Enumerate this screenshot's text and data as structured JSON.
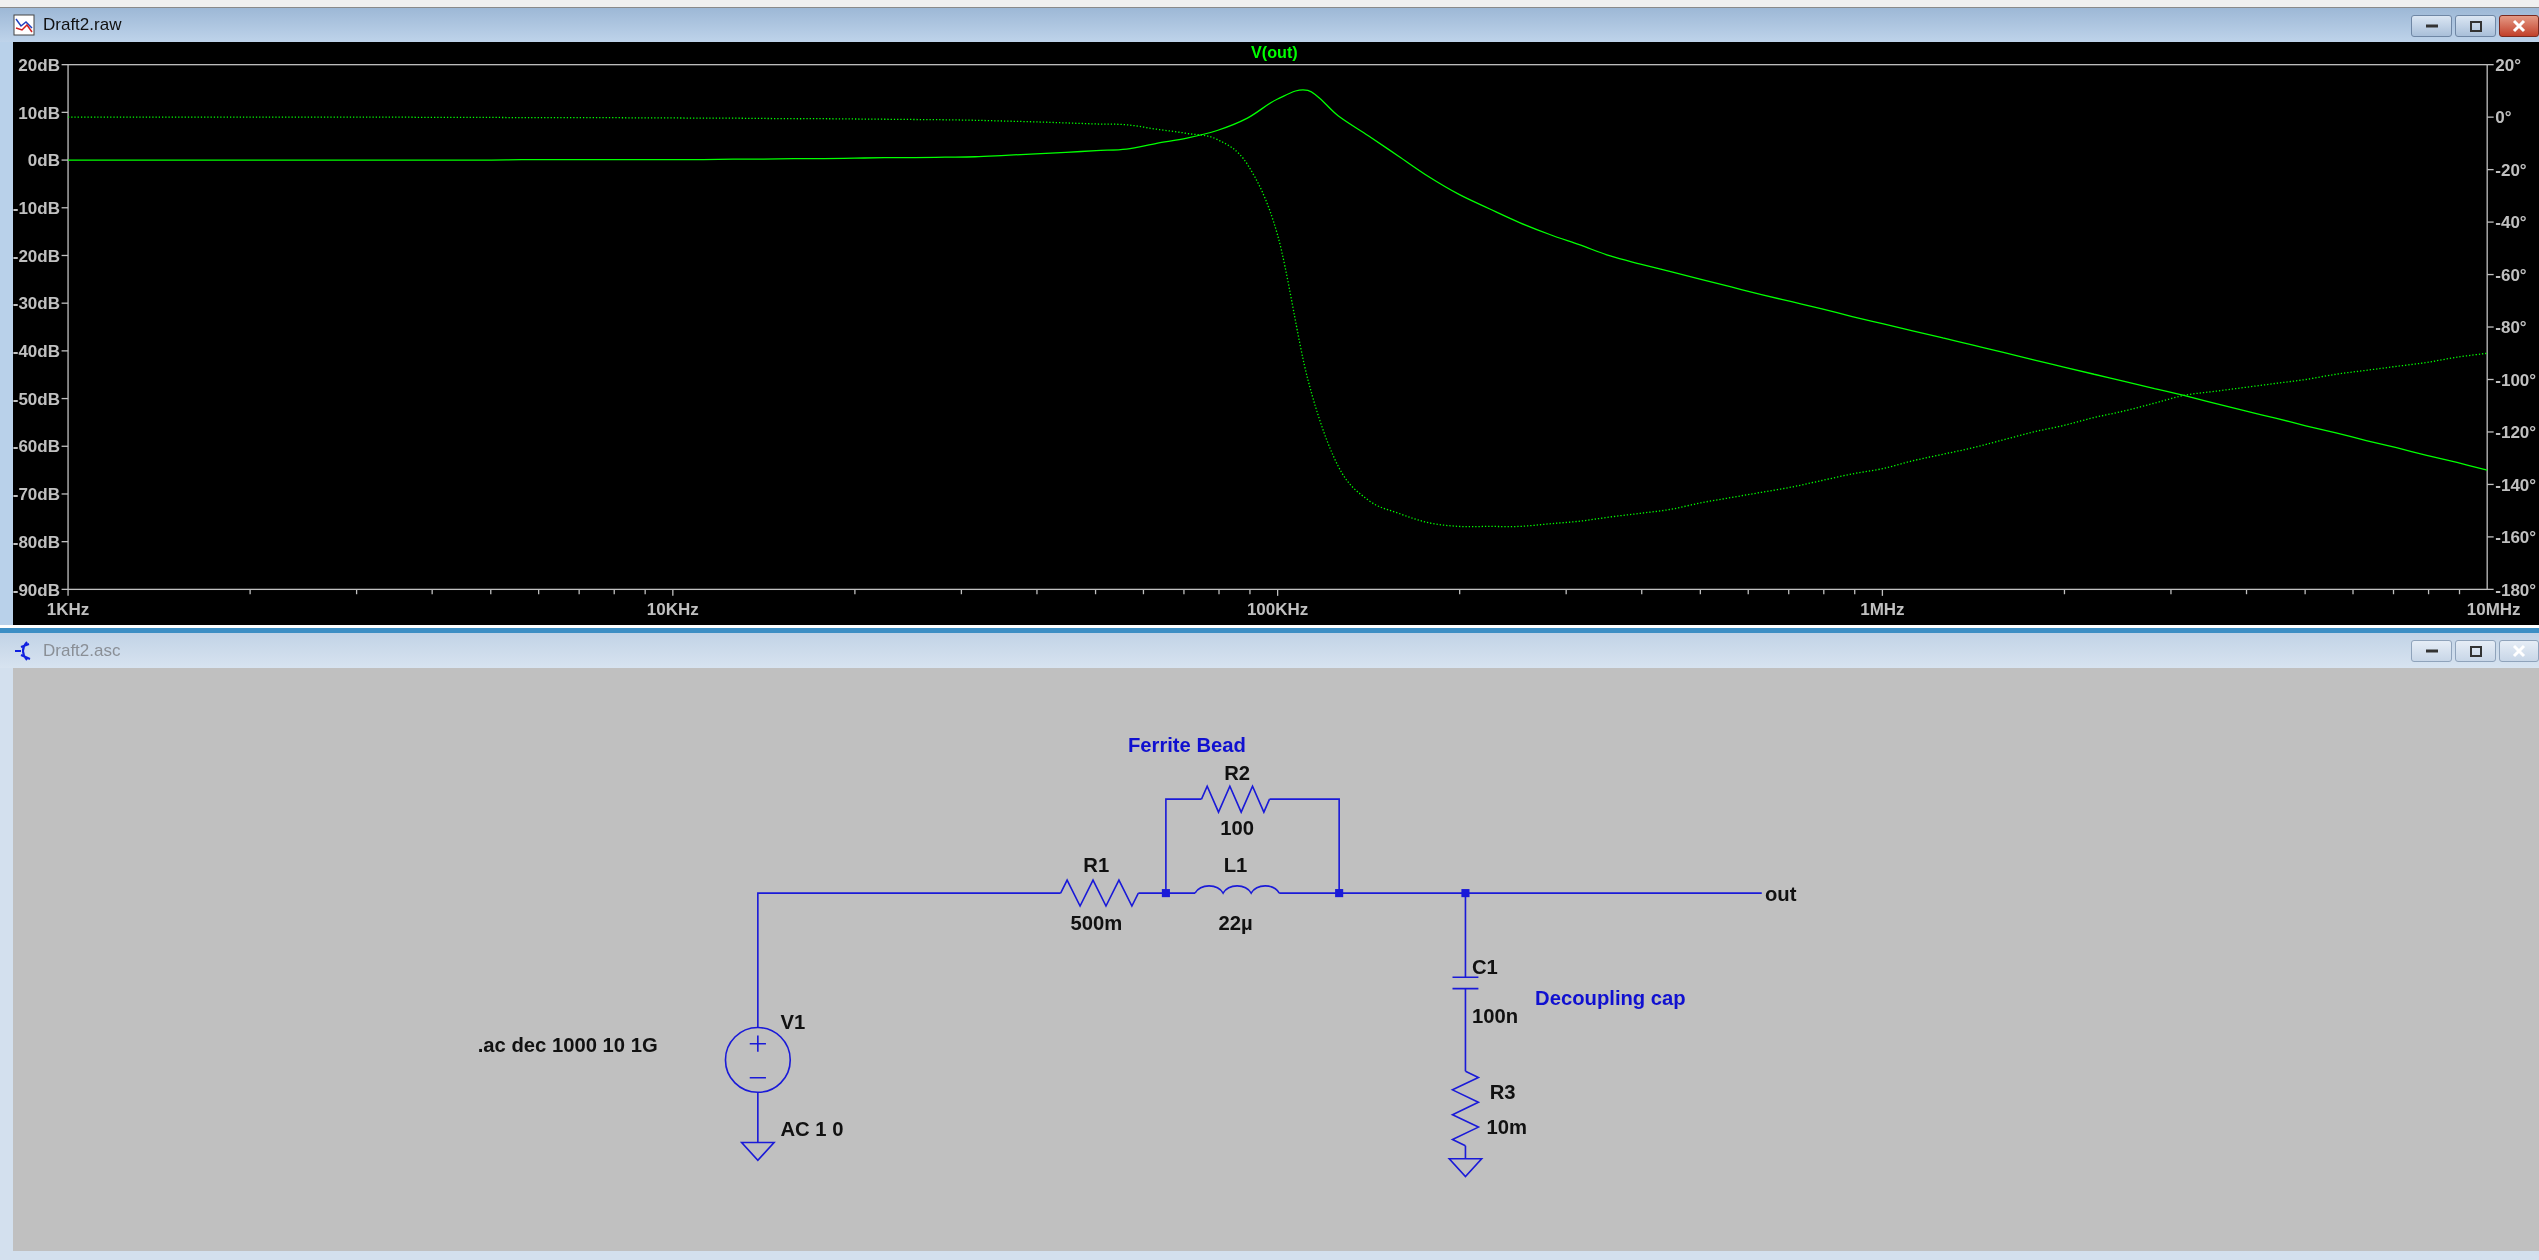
{
  "windows": [
    {
      "title": "Draft2.raw",
      "active": true,
      "kind": "waveform",
      "chart_data": {
        "type": "line",
        "title": "V(out)",
        "categories": [
          "1KHz",
          null,
          null,
          null,
          null,
          null,
          null,
          null,
          null,
          null,
          null,
          null,
          null,
          null,
          null,
          null,
          null,
          null,
          null,
          null,
          "10KHz",
          null,
          null,
          null,
          null,
          null,
          null,
          null,
          null,
          null,
          null,
          null,
          null,
          null,
          null,
          null,
          null,
          null,
          null,
          null,
          "100KHz",
          null,
          null,
          null,
          null,
          null,
          null,
          null,
          null,
          null,
          null,
          null,
          null,
          null,
          null,
          null,
          null,
          null,
          null,
          null,
          "1MHz",
          null,
          null,
          null,
          null,
          null,
          null,
          null,
          null,
          null,
          null,
          null,
          null,
          null,
          null,
          null,
          null,
          null,
          null,
          null,
          "10MHz"
        ],
        "series": [
          {
            "color": "#00ff00",
            "line_style": "solid",
            "values": [
              0,
              0,
              0,
              0,
              0,
              0,
              0,
              0,
              0,
              0,
              0,
              0,
              0,
              0,
              0,
              0.1,
              0.1,
              0.1,
              0.1,
              0.1,
              0.1,
              0.1,
              0.2,
              0.2,
              0.3,
              0.3,
              0.4,
              0.5,
              0.5,
              0.6,
              0.7,
              1.0,
              1.3,
              1.6,
              2.0,
              2.3,
              3.5,
              4.6,
              6.2,
              8.8,
              12.8,
              14.6,
              9.3,
              5.1,
              0.8,
              -3.5,
              -7.2,
              -10.2,
              -13.1,
              -15.6,
              -17.8,
              -20.1,
              -21.8,
              -23.4,
              -25,
              -26.6,
              -28.2,
              -29.7,
              -31.2,
              -32.8,
              -34.3,
              -35.8,
              -37.3,
              -38.8,
              -40.3,
              -41.9,
              -43.4,
              -44.9,
              -46.4,
              -47.9,
              -49.4,
              -51,
              -52.6,
              -54.1,
              -55.7,
              -57.2,
              -58.8,
              -60.3,
              -61.9,
              -63.4,
              -65
            ]
          },
          {
            "color": "#00ff00",
            "axis": "y2",
            "line_style": "dotted",
            "values": [
              0,
              0,
              0,
              0,
              0,
              0,
              0,
              0,
              0,
              0,
              0,
              0,
              -0.1,
              -0.1,
              -0.1,
              -0.2,
              -0.2,
              -0.2,
              -0.2,
              -0.3,
              -0.3,
              -0.4,
              -0.4,
              -0.5,
              -0.6,
              -0.6,
              -0.7,
              -0.8,
              -0.9,
              -1,
              -1.2,
              -1.5,
              -1.8,
              -2.2,
              -2.6,
              -2.9,
              -4.6,
              -6.2,
              -8.5,
              -18,
              -45,
              -100,
              -133,
              -146,
              -151,
              -154.6,
              -156,
              -156,
              -156,
              -155,
              -154,
              -152.4,
              -151,
              -149.5,
              -147,
              -145,
              -143,
              -141,
              -138.5,
              -136,
              -134,
              -131,
              -128.5,
              -126,
              -123,
              -120,
              -117.5,
              -114.5,
              -112,
              -109,
              -106,
              -104.5,
              -103,
              -101.5,
              -100,
              -98,
              -96.5,
              -95,
              -93.5,
              -91.5,
              -90
            ]
          }
        ],
        "ylim": [
          -90,
          20
        ],
        "y2lim": [
          -180,
          20
        ],
        "yticks": [
          {
            "value": 20,
            "label": "20dB"
          },
          {
            "value": 10,
            "label": "10dB"
          },
          {
            "value": 0,
            "label": "0dB"
          },
          {
            "value": -10,
            "label": "-10dB"
          },
          {
            "value": -20,
            "label": "-20dB"
          },
          {
            "value": -30,
            "label": "-30dB"
          },
          {
            "value": -40,
            "label": "-40dB"
          },
          {
            "value": -50,
            "label": "-50dB"
          },
          {
            "value": -60,
            "label": "-60dB"
          },
          {
            "value": -70,
            "label": "-70dB"
          },
          {
            "value": -80,
            "label": "-80dB"
          },
          {
            "value": -90,
            "label": "-90dB"
          }
        ],
        "y2ticks": [
          {
            "value": 20,
            "label": "20°"
          },
          {
            "value": 0,
            "label": "0°"
          },
          {
            "value": -20,
            "label": "-20°"
          },
          {
            "value": -40,
            "label": "-40°"
          },
          {
            "value": -60,
            "label": "-60°"
          },
          {
            "value": -80,
            "label": "-80°"
          },
          {
            "value": -100,
            "label": "-100°"
          },
          {
            "value": -120,
            "label": "-120°"
          },
          {
            "value": -140,
            "label": "-140°"
          },
          {
            "value": -160,
            "label": "-160°"
          },
          {
            "value": -180,
            "label": "-180°"
          }
        ]
      }
    },
    {
      "title": "Draft2.asc",
      "active": false,
      "kind": "schematic",
      "schematic": {
        "components": [
          {
            "kind": "voltage_source",
            "ref": "V1",
            "value": "AC 1 0"
          },
          {
            "kind": "resistor",
            "ref": "R1",
            "value": "500m"
          },
          {
            "kind": "resistor",
            "ref": "R2",
            "value": "100"
          },
          {
            "kind": "inductor",
            "ref": "L1",
            "value": "22µ"
          },
          {
            "kind": "capacitor",
            "ref": "C1",
            "value": "100n"
          },
          {
            "kind": "resistor",
            "ref": "R3",
            "value": "10m"
          }
        ],
        "net_labels": [
          "out"
        ],
        "comments": [
          "Ferrite Bead",
          "Decoupling cap"
        ],
        "directive": ".ac dec 1000 10 1G"
      }
    }
  ]
}
